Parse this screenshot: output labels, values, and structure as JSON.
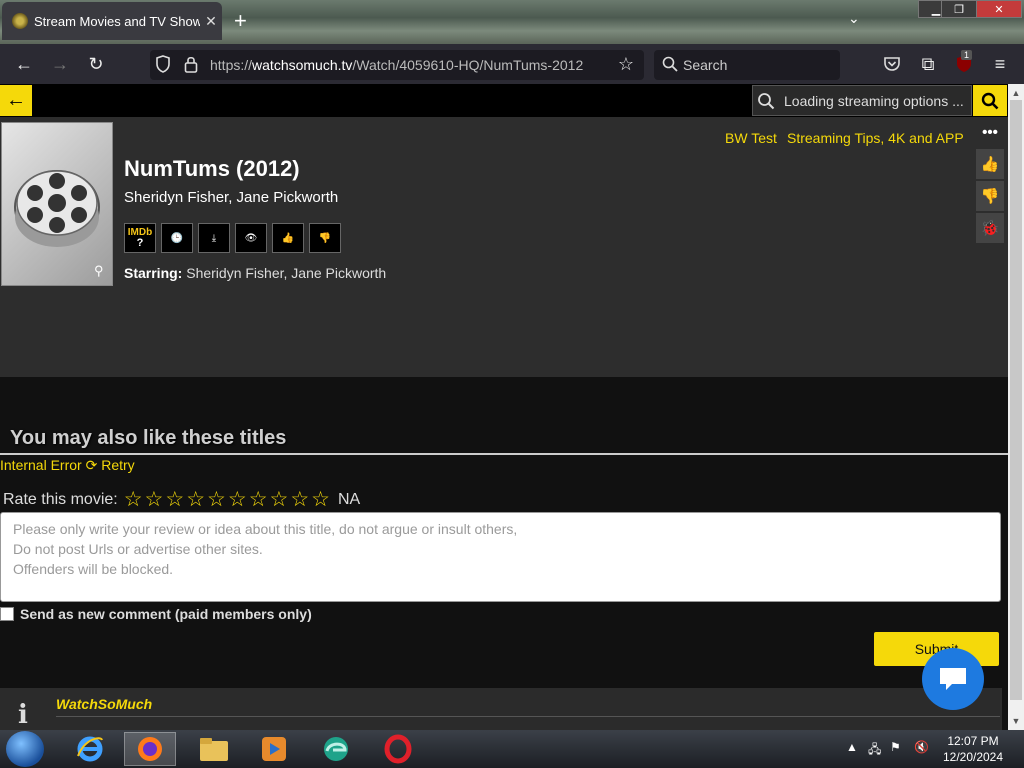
{
  "browser": {
    "tab_title": "Stream Movies and TV Shows F",
    "url_prefix": "https://",
    "url_host": "watchsomuch.tv",
    "url_path": "/Watch/4059610-HQ/NumTums-2012",
    "search_placeholder": "Search",
    "extension_badge": "1"
  },
  "site": {
    "search_placeholder": "Loading streaming options ...",
    "top_links": [
      "BW Test",
      "Streaming Tips, 4K and APP"
    ]
  },
  "movie": {
    "title": "NumTums (2012)",
    "subtitle": "Sheridyn Fisher, Jane Pickworth",
    "imdb_label": "IMDb",
    "imdb_value": "?",
    "starring_label": "Starring:",
    "starring_value": "Sheridyn Fisher, Jane Pickworth"
  },
  "section": {
    "also_like": "You may also like these titles",
    "error_text": "Internal Error",
    "retry_text": "Retry"
  },
  "rating": {
    "label": "Rate this movie:",
    "star_count": 10,
    "value_text": "NA"
  },
  "comment": {
    "placeholder": "Please only write your review or idea about this title, do not argue or insult others,\nDo not post Urls or advertise other sites.\nOffenders will be blocked.",
    "checkbox_label": "Send as new comment (paid members only)",
    "submit_label": "Submit"
  },
  "footer": {
    "site_name": "WatchSoMuch",
    "info_glyph": "i"
  },
  "taskbar": {
    "time": "12:07 PM",
    "date": "12/20/2024"
  },
  "colors": {
    "accent": "#f5d90a",
    "page_bg": "#111111",
    "hero_bg": "#2d2d2d"
  }
}
